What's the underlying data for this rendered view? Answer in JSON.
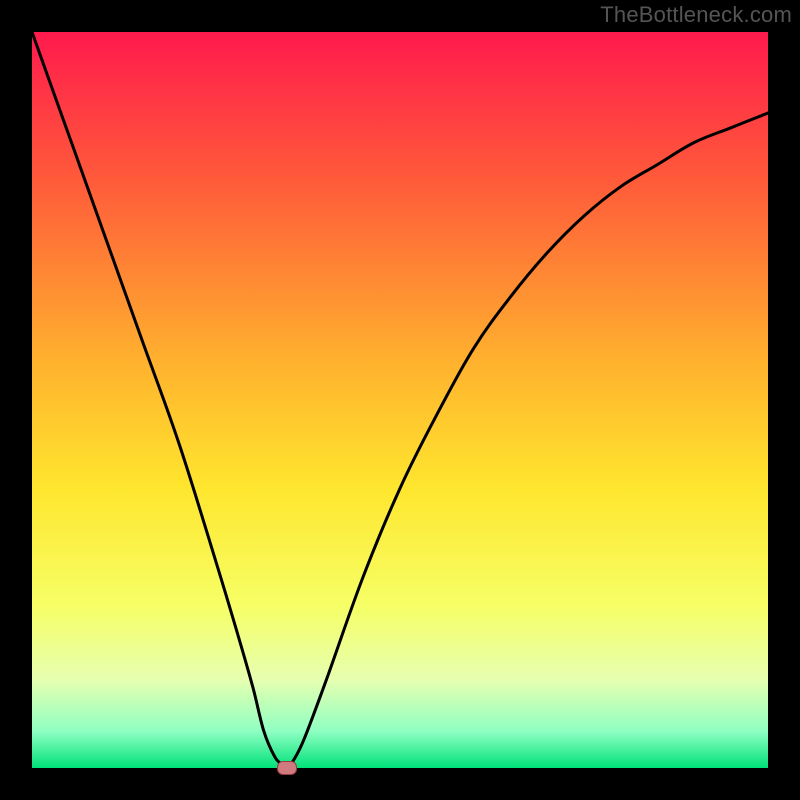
{
  "watermark": "TheBottleneck.com",
  "chart_data": {
    "type": "line",
    "title": "",
    "xlabel": "",
    "ylabel": "",
    "xlim": [
      0,
      100
    ],
    "ylim": [
      0,
      100
    ],
    "gradient_stops": [
      {
        "offset": 0,
        "color": "#ff1a4d"
      },
      {
        "offset": 20,
        "color": "#ff5a3a"
      },
      {
        "offset": 45,
        "color": "#ffb22e"
      },
      {
        "offset": 62,
        "color": "#ffe62e"
      },
      {
        "offset": 78,
        "color": "#f6ff66"
      },
      {
        "offset": 88,
        "color": "#e6ffb0"
      },
      {
        "offset": 95,
        "color": "#8fffc2"
      },
      {
        "offset": 100,
        "color": "#00e27a"
      }
    ],
    "series": [
      {
        "name": "bottleneck-curve",
        "x": [
          0,
          5,
          10,
          15,
          20,
          25,
          28,
          30,
          31.5,
          33,
          34,
          34.7,
          35.5,
          37,
          40,
          45,
          50,
          55,
          60,
          65,
          70,
          75,
          80,
          85,
          90,
          95,
          100
        ],
        "y": [
          100,
          86,
          72,
          58,
          44,
          28,
          18,
          11,
          5,
          1.5,
          0.5,
          0,
          1,
          4,
          12,
          26,
          38,
          48,
          57,
          64,
          70,
          75,
          79,
          82,
          85,
          87,
          89
        ]
      }
    ],
    "marker": {
      "x": 34.7,
      "y": 0
    }
  }
}
